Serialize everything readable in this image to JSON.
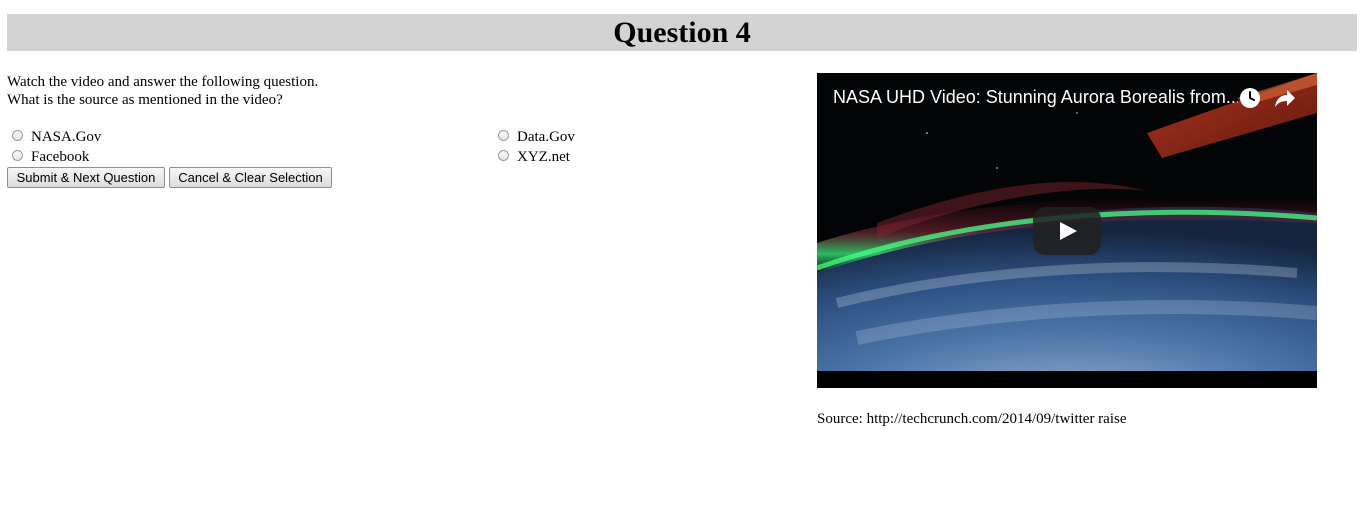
{
  "header": {
    "title": "Question 4"
  },
  "question": {
    "instruction": "Watch the video and answer the following question.",
    "prompt": "What is the source as mentioned in the video?"
  },
  "options": [
    {
      "label": "NASA.Gov",
      "checked": false
    },
    {
      "label": "Data.Gov",
      "checked": false
    },
    {
      "label": "Facebook",
      "checked": false
    },
    {
      "label": "XYZ.net",
      "checked": false
    }
  ],
  "buttons": {
    "submit_label": "Submit & Next Question",
    "cancel_label": "Cancel & Clear Selection"
  },
  "video": {
    "title": "NASA UHD Video: Stunning Aurora Borealis from...",
    "icons": [
      "clock-icon",
      "share-icon",
      "play-icon"
    ]
  },
  "source": {
    "text": "Source: http://techcrunch.com/2014/09/twitter raise"
  },
  "colors": {
    "header_bg": "#d3d3d3",
    "aurora_green": "#3ee07a",
    "earth_blue": "#3f6fa8"
  }
}
